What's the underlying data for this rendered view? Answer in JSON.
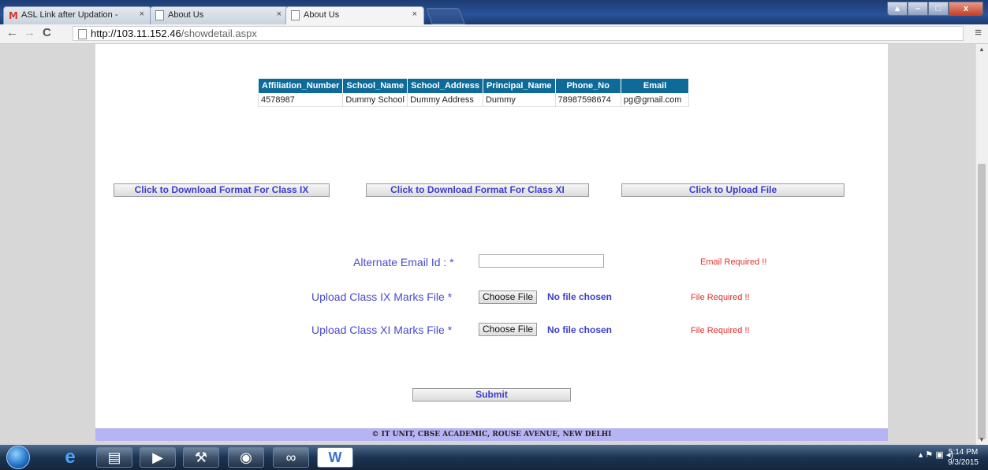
{
  "browser": {
    "tabs": [
      {
        "title": "ASL Link after Updation -",
        "icon": "gmail-icon"
      },
      {
        "title": "About Us",
        "icon": "page-icon"
      },
      {
        "title": "About Us",
        "icon": "page-icon"
      }
    ],
    "tab_close": "×",
    "url_host": "http://103.11.152.46",
    "url_path": "/showdetail.aspx",
    "back": "←",
    "forward": "→",
    "reload": "C",
    "menu": "≡"
  },
  "table": {
    "headers": [
      "Affiliation_Number",
      "School_Name",
      "School_Address",
      "Principal_Name",
      "Phone_No",
      "Email"
    ],
    "rows": [
      [
        "4578987",
        "Dummy School",
        "Dummy Address",
        "Dummy",
        "78987598674",
        "pg@gmail.com"
      ]
    ]
  },
  "buttons": {
    "download_ix": "Click to Download Format For Class IX",
    "download_xi": "Click to Download Format For Class XI",
    "upload": "Click to Upload File",
    "submit": "Submit"
  },
  "form": {
    "email_label": "Alternate Email Id : *",
    "email_value": "",
    "email_error": "Email Required !!",
    "ix_label": "Upload Class IX Marks File *",
    "ix_choose": "Choose File",
    "ix_status": "No file chosen",
    "ix_error": "File Required !!",
    "xi_label": "Upload Class XI Marks File *",
    "xi_choose": "Choose File",
    "xi_status": "No file chosen",
    "xi_error": "File Required !!"
  },
  "footer": "© IT UNIT, CBSE ACADEMIC, ROUSE AVENUE, NEW DELHI",
  "taskbar": {
    "time": "5:14 PM",
    "date": "9/3/2015",
    "icons": [
      "ie-icon",
      "explorer-icon",
      "media-player-icon",
      "tools-icon",
      "chrome-icon",
      "infinity-icon",
      "word-icon"
    ]
  },
  "colors": {
    "table_header": "#0e6b99",
    "label_blue": "#4a4ad0",
    "error_red": "#e0302a",
    "footer_bg": "#b6b4f4"
  }
}
